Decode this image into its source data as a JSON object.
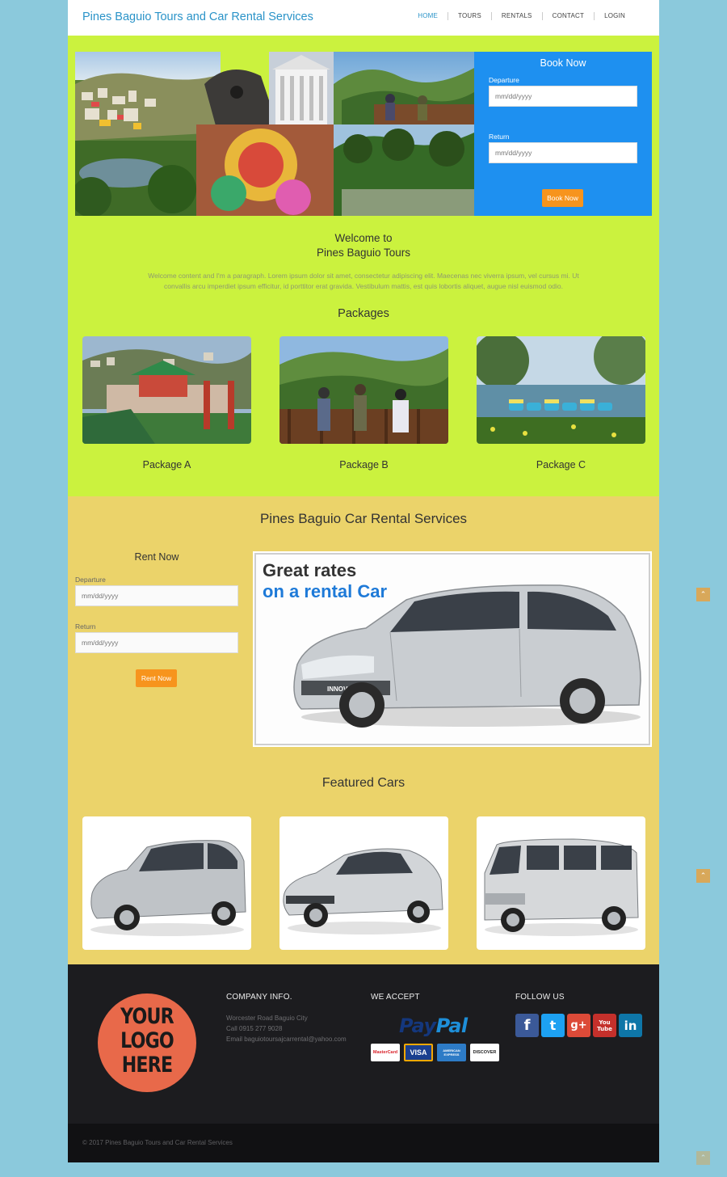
{
  "header": {
    "brand": "Pines Baguio Tours and Car Rental Services",
    "nav": [
      "HOME",
      "TOURS",
      "RENTALS",
      "CONTACT",
      "LOGIN"
    ],
    "active": "HOME"
  },
  "book": {
    "title": "Book Now",
    "departure_label": "Departure",
    "departure_placeholder": "mm/dd/yyyy",
    "return_label": "Return",
    "return_placeholder": "mm/dd/yyyy",
    "button": "Book Now"
  },
  "welcome": {
    "line1": "Welcome to",
    "line2": "Pines Baguio Tours",
    "paragraph": "Welcome content and I'm a paragraph. Lorem ipsum dolor sit amet, consectetur adipiscing elit. Maecenas nec viverra ipsum, vel cursus mi. Ut convallis arcu imperdiet ipsum efficitur, id porttitor erat gravida. Vestibulum mattis, est quis lobortis aliquet, augue nisl euismod odio."
  },
  "packages": {
    "title": "Packages",
    "items": [
      {
        "label": "Package A"
      },
      {
        "label": "Package B"
      },
      {
        "label": "Package C"
      }
    ]
  },
  "rental": {
    "title": "Pines Baguio Car Rental Services",
    "rent_title": "Rent Now",
    "departure_label": "Departure",
    "departure_placeholder": "mm/dd/yyyy",
    "return_label": "Return",
    "return_placeholder": "mm/dd/yyyy",
    "button": "Rent Now",
    "ad_line1": "Great rates",
    "ad_line2": "on a rental Car",
    "ad_plate": "INNOVA"
  },
  "featured": {
    "title": "Featured Cars"
  },
  "footer": {
    "logo_lines": [
      "YOUR",
      "LOGO",
      "HERE"
    ],
    "company_heading": "COMPANY INFO.",
    "address": "Worcester Road Baguio City",
    "phone": "Call 0915 277 9028",
    "email": "Email baguiotoursajcarrental@yahoo.com",
    "accept_heading": "WE ACCEPT",
    "paypal_pay": "Pay",
    "paypal_pal": "Pal",
    "cards": [
      "MasterCard",
      "VISA",
      "AMERICAN EXPRESS",
      "DISCOVER"
    ],
    "follow_heading": "FOLLOW US",
    "social": [
      "f",
      "t",
      "g+",
      "You Tube",
      "in"
    ],
    "copyright": "© 2017 Pines Baguio Tours and Car Rental Services"
  },
  "colors": {
    "background": "#8bc9dc",
    "green_section": "#cbf23e",
    "yellow_section": "#ebd36a",
    "book_panel": "#1e90f0",
    "button": "#f7941d",
    "brand": "#2a93c8",
    "footer": "#1c1c1f"
  },
  "icons": [
    "chevron-up-icon"
  ]
}
